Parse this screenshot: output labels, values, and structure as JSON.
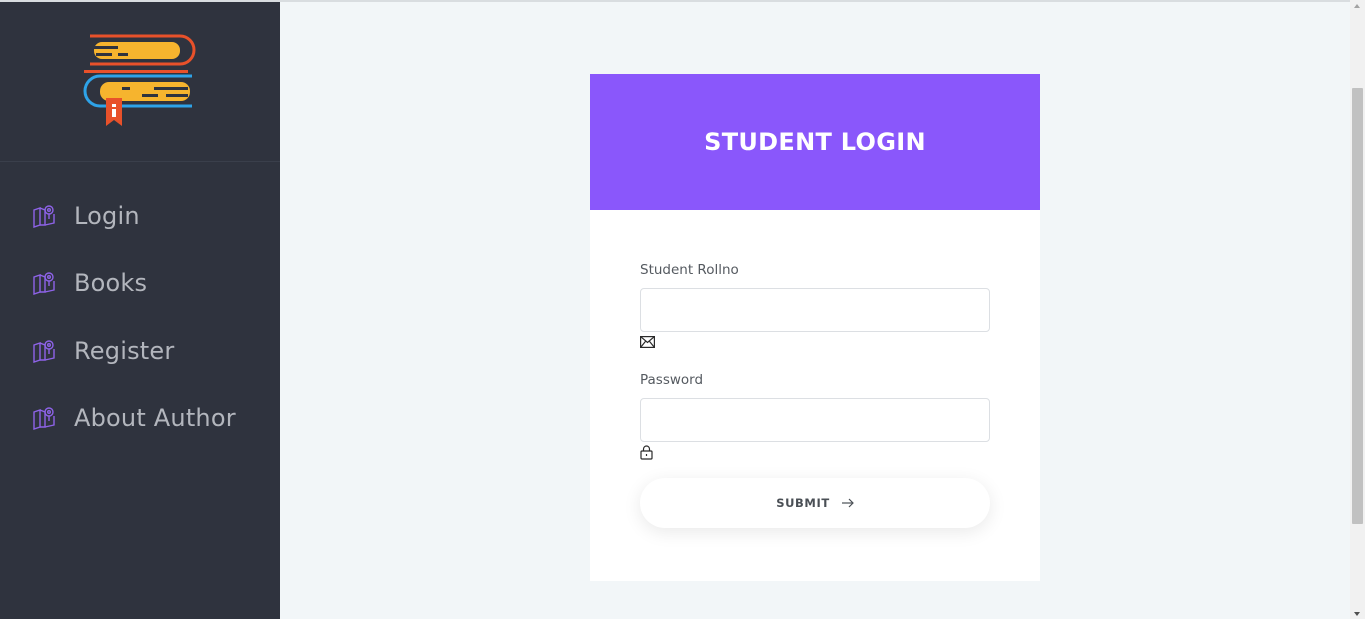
{
  "logo": {
    "icon": "books-logo-icon"
  },
  "sidebar": {
    "items": [
      {
        "label": "Login",
        "icon": "map-pin-icon"
      },
      {
        "label": "Books",
        "icon": "map-pin-icon"
      },
      {
        "label": "Register",
        "icon": "map-pin-icon"
      },
      {
        "label": "About Author",
        "icon": "map-pin-icon"
      }
    ]
  },
  "login": {
    "title": "STUDENT LOGIN",
    "rollno_label": "Student Rollno",
    "rollno_value": "",
    "rollno_icon": "envelope-icon",
    "password_label": "Password",
    "password_value": "",
    "password_icon": "lock-icon",
    "submit_label": "SUBMIT",
    "submit_icon": "arrow-right-icon"
  },
  "colors": {
    "sidebar_bg": "#2f333e",
    "accent": "#8a57fb",
    "page_bg": "#f2f6f8",
    "nav_text": "#b3b6bd"
  }
}
